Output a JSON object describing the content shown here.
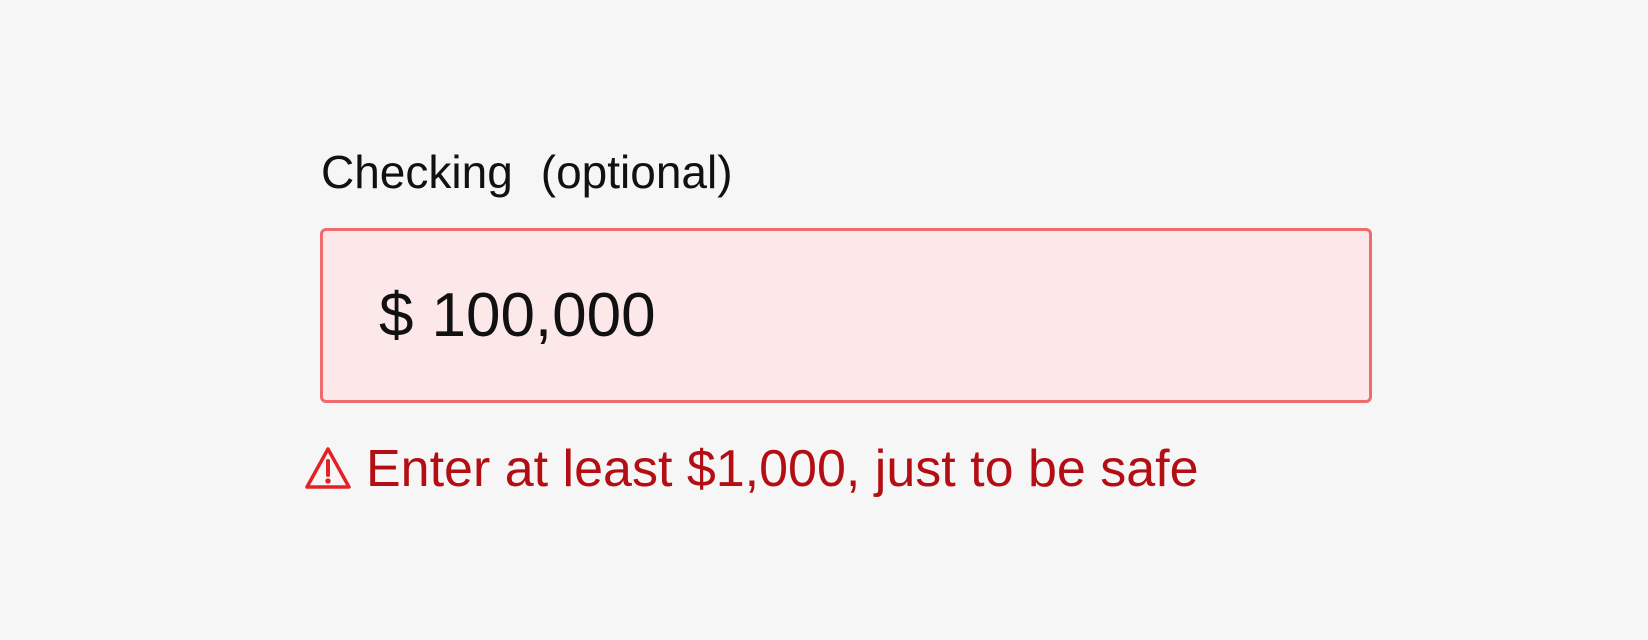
{
  "field": {
    "label": "Checking",
    "optional_text": "(optional)",
    "currency_symbol": "$",
    "value": "100,000",
    "error_message": "Enter at least $1,000, just to be safe"
  },
  "icons": {
    "warning": "warning-icon"
  },
  "colors": {
    "page_background": "#f7f6f6",
    "input_background": "#fde8e9",
    "input_border": "#ef6b6e",
    "error_text": "#b30e13",
    "primary_text": "#111111"
  }
}
